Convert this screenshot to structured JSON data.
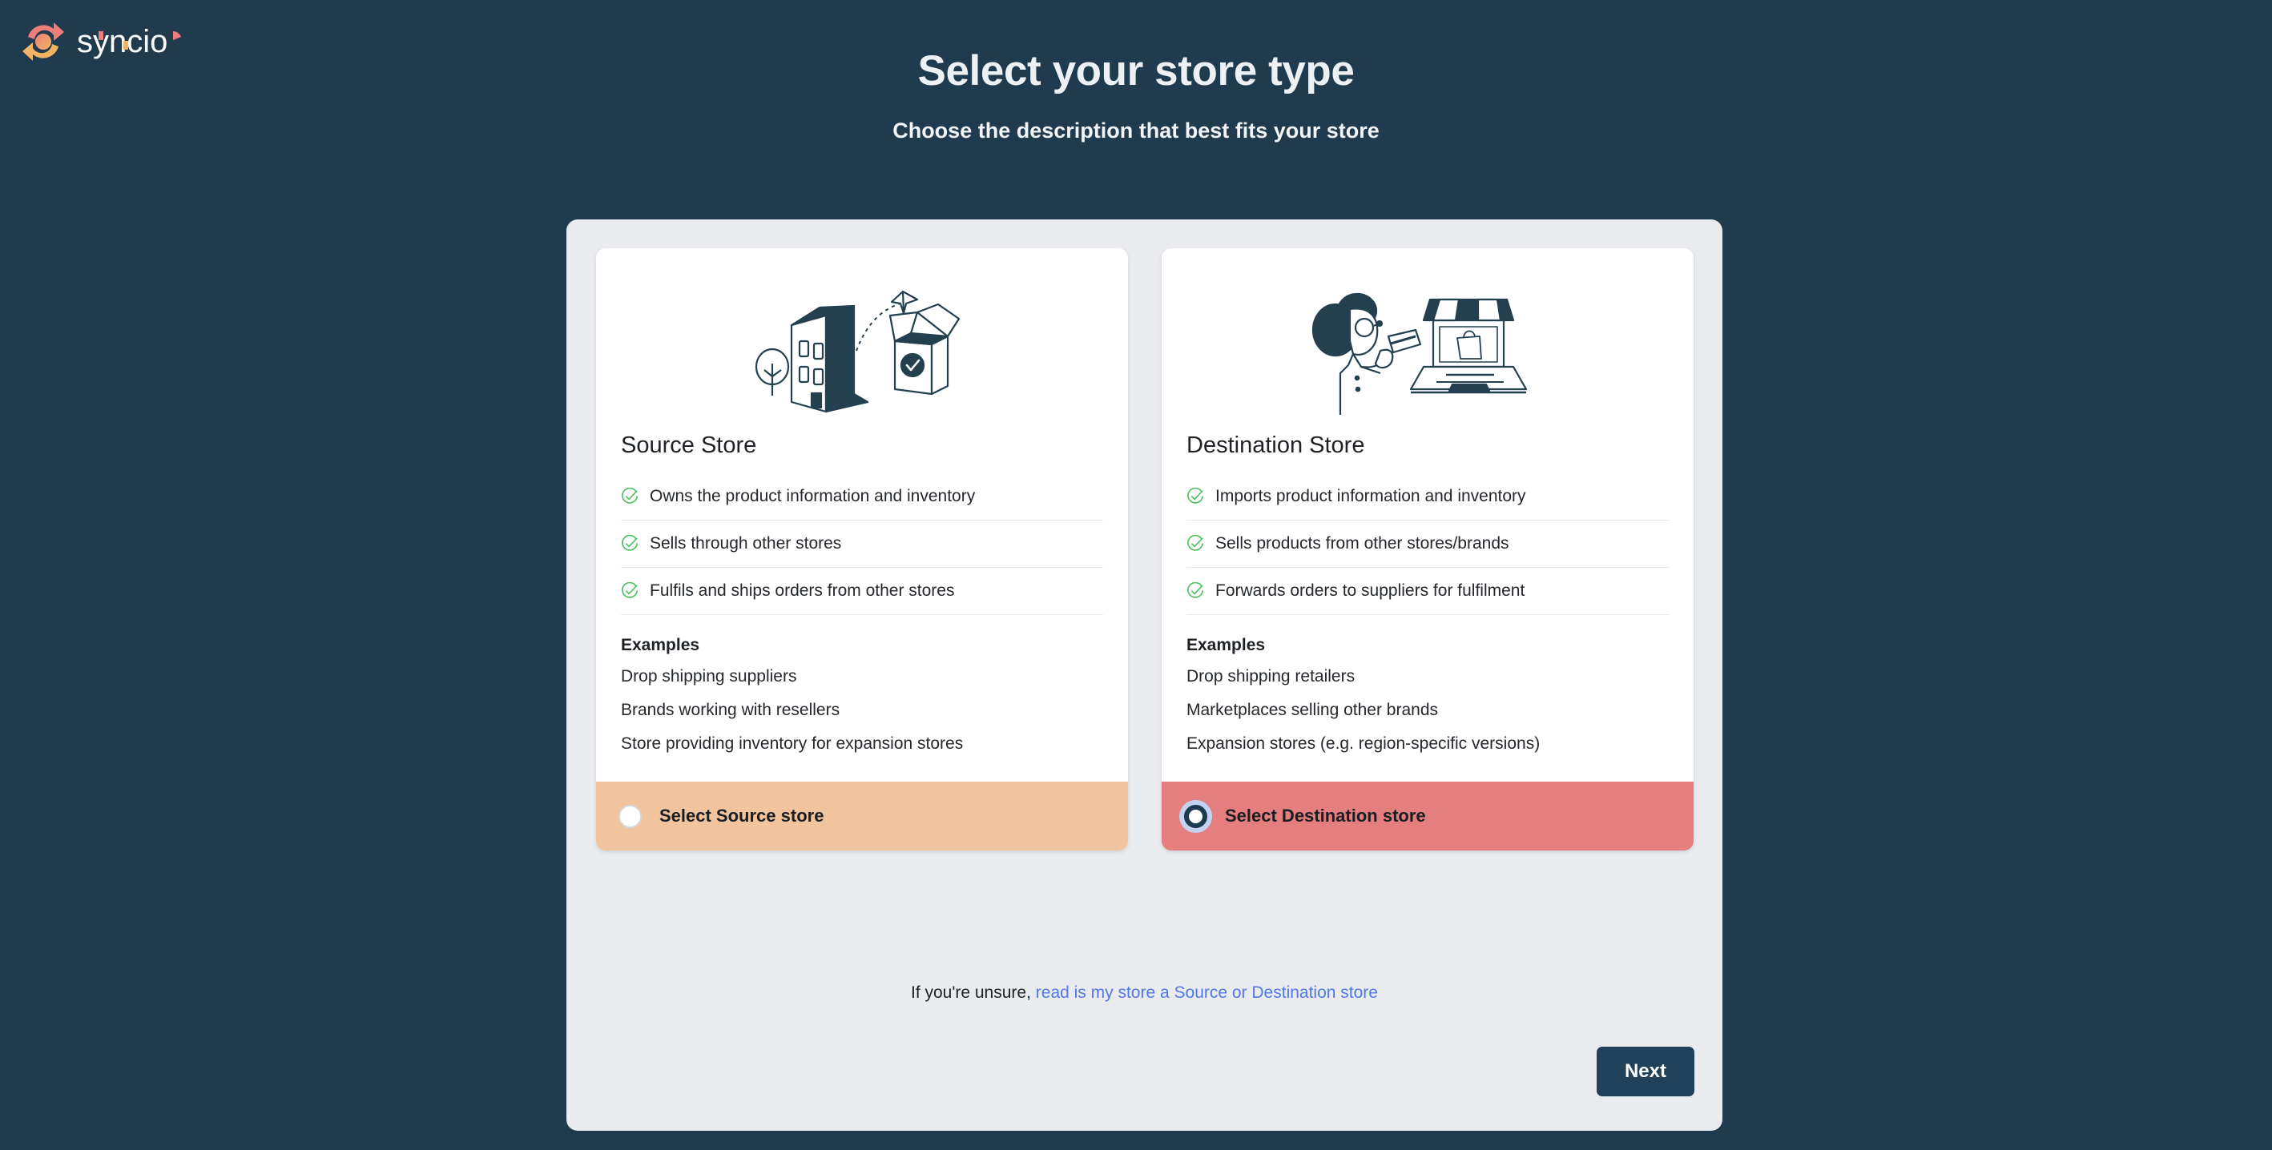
{
  "brand": {
    "name": "syncio",
    "logo_icon": "syncio-circular-arrow-logo",
    "colors": {
      "coral": "#EE7E7B",
      "amber": "#F2B462",
      "page_background": "#1F3B4D"
    }
  },
  "header": {
    "title": "Select your store type",
    "subtitle": "Choose the description that best fits your store"
  },
  "cards": [
    {
      "id": "source",
      "illustration_icon": "building-and-package-illustration",
      "heading": "Source Store",
      "features": [
        "Owns the product information and inventory",
        "Sells through other stores",
        "Fulfils and ships orders from other stores"
      ],
      "examples_title": "Examples",
      "examples": [
        "Drop shipping suppliers",
        "Brands working with resellers",
        "Store providing inventory for expansion stores"
      ],
      "select_label": "Select Source store",
      "selected": false,
      "footer_color": "#F1C49D"
    },
    {
      "id": "destination",
      "illustration_icon": "shopper-and-laptop-storefront-illustration",
      "heading": "Destination Store",
      "features": [
        "Imports product information and inventory",
        "Sells products from other stores/brands",
        "Forwards orders to suppliers for fulfilment"
      ],
      "examples_title": "Examples",
      "examples": [
        "Drop shipping retailers",
        "Marketplaces selling other brands",
        "Expansion stores (e.g. region-specific versions)"
      ],
      "select_label": "Select Destination store",
      "selected": true,
      "footer_color": "#E57E7E"
    }
  ],
  "helper": {
    "prefix": "If you're unsure,",
    "link_text": "read is my store a Source or Destination store",
    "link_color": "#5079E8"
  },
  "actions": {
    "next_label": "Next"
  },
  "icons": {
    "check": "green-circle-check-icon",
    "radio_unselected": "radio-unselected-icon",
    "radio_selected": "radio-selected-icon"
  }
}
